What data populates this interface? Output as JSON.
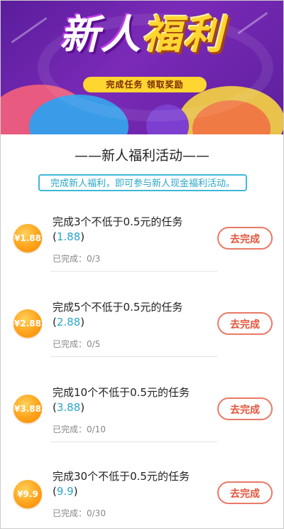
{
  "banner": {
    "title_white": "新人",
    "title_yellow": "福利",
    "subtitle": "完成任务 领取奖励"
  },
  "section": {
    "title": "——新人福利活动——",
    "notice": "完成新人福利，即可参与新人现金福利活动。"
  },
  "tasks": [
    {
      "coin": "¥1.88",
      "title": "完成3个不低于0.5元的任务",
      "amount": "1.88",
      "progress": "已完成：0/3",
      "button": "去完成"
    },
    {
      "coin": "¥2.88",
      "title": "完成5个不低于0.5元的任务",
      "amount": "2.88",
      "progress": "已完成：0/5",
      "button": "去完成"
    },
    {
      "coin": "¥3.88",
      "title": "完成10个不低于0.5元的任务",
      "amount": "3.88",
      "progress": "已完成：0/10",
      "button": "去完成"
    },
    {
      "coin": "¥9.9",
      "title": "完成30个不低于0.5元的任务",
      "amount": "9.9",
      "progress": "已完成：0/30",
      "button": "去完成"
    }
  ],
  "colors": {
    "banner_bg": "#6b24ad",
    "accent_blue": "#2aa6c8",
    "button_red": "#e2553a",
    "coin_orange": "#ffa21a"
  }
}
